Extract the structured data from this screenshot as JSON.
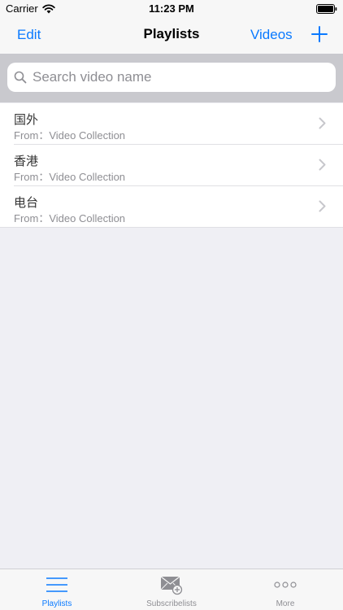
{
  "status_bar": {
    "carrier": "Carrier",
    "time": "11:23 PM"
  },
  "nav": {
    "edit_label": "Edit",
    "title": "Playlists",
    "videos_label": "Videos"
  },
  "search": {
    "placeholder": "Search video name",
    "value": ""
  },
  "playlists": [
    {
      "title": "国外",
      "subtitle": "From：Video Collection"
    },
    {
      "title": "香港",
      "subtitle": "From：Video Collection"
    },
    {
      "title": "电台",
      "subtitle": "From：Video Collection"
    }
  ],
  "tab_bar": {
    "tabs": [
      {
        "label": "Playlists",
        "icon": "list-icon",
        "active": true
      },
      {
        "label": "Subscribelists",
        "icon": "mail-add-icon",
        "active": false
      },
      {
        "label": "More",
        "icon": "more-dots-icon",
        "active": false
      }
    ]
  },
  "colors": {
    "accent": "#0a7aff",
    "background": "#efeff4",
    "search_bar_bg": "#c9c9ce",
    "secondary_text": "#8e8e93"
  }
}
